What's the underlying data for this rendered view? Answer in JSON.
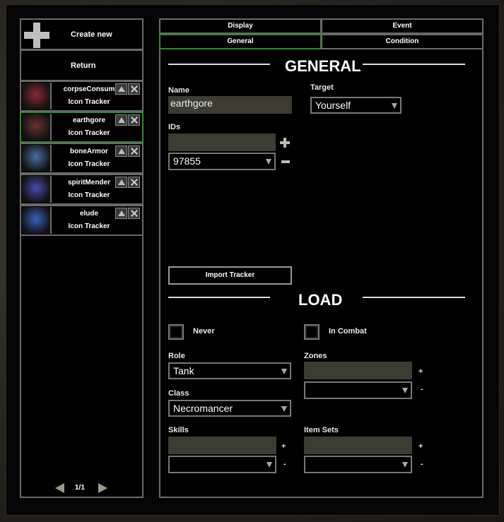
{
  "sidebar": {
    "create_new": "Create new",
    "return": "Return",
    "trackers": [
      {
        "name": "corpseConsum",
        "type": "Icon Tracker",
        "icon": "corpse-consume-icon",
        "color": "#8a2a3a",
        "selected": false
      },
      {
        "name": "earthgore",
        "type": "Icon Tracker",
        "icon": "earthgore-icon",
        "color": "#6b3030",
        "selected": true
      },
      {
        "name": "boneArmor",
        "type": "Icon Tracker",
        "icon": "bone-armor-icon",
        "color": "#4a6fa0",
        "selected": false
      },
      {
        "name": "spiritMender",
        "type": "Icon Tracker",
        "icon": "spirit-mender-icon",
        "color": "#4a4ab0",
        "selected": false
      },
      {
        "name": "elude",
        "type": "Icon Tracker",
        "icon": "elude-icon",
        "color": "#3a60c0",
        "selected": false
      }
    ],
    "page": "1/1"
  },
  "tabs": {
    "display": "Display",
    "event": "Event",
    "general": "General",
    "condition": "Condition",
    "active": "General"
  },
  "general": {
    "header": "GENERAL",
    "name_label": "Name",
    "name_value": "earthgore",
    "target_label": "Target",
    "target_value": "Yourself",
    "ids_label": "IDs",
    "ids_input": "",
    "ids_selected": "97855",
    "import_button": "Import Tracker"
  },
  "load": {
    "header": "LOAD",
    "never_label": "Never",
    "in_combat_label": "In Combat",
    "role_label": "Role",
    "role_value": "Tank",
    "class_label": "Class",
    "class_value": "Necromancer",
    "zones_label": "Zones",
    "skills_label": "Skills",
    "item_sets_label": "Item Sets",
    "plus": "+",
    "minus": "-"
  },
  "colors": {
    "selected_border": "#2f8a2f",
    "panel_border": "#6a6a6a",
    "input_bg": "#3c3c32"
  }
}
